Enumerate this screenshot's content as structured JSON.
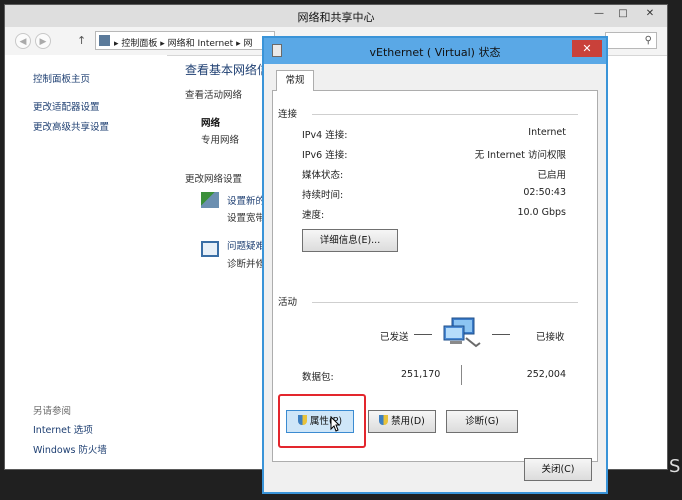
{
  "background_window": {
    "title": "网络和共享中心",
    "window_buttons": {
      "minimize": "—",
      "maximize": "□",
      "close": "✕"
    },
    "nav": {
      "back": "◀",
      "forward": "▶",
      "up": "↑",
      "breadcrumb": "▸ 控制面板 ▸ 网络和 Internet ▸ 网"
    },
    "left_pane": {
      "home_link": "控制面板主页",
      "adapter_link": "更改适配器设置",
      "advanced_link": "更改高级共享设置",
      "see_also": "另请参阅",
      "internet_options": "Internet 选项",
      "firewall": "Windows 防火墙"
    },
    "main": {
      "title": "查看基本网络信",
      "active_networks": "查看活动网络",
      "network_name": "网络",
      "network_type": "专用网络",
      "change_settings": "更改网络设置",
      "setup_link": "设置新的",
      "setup_desc": "设置宽带",
      "troubleshoot_link": "问题疑难",
      "troubleshoot_desc": "诊断并修"
    },
    "overflow_letter": "S"
  },
  "dialog": {
    "title": "vEthernet ( Virtual) 状态",
    "close_glyph": "✕",
    "tab_general": "常规",
    "connection": {
      "group_label": "连接",
      "rows": [
        {
          "label": "IPv4 连接:",
          "value": "Internet"
        },
        {
          "label": "IPv6 连接:",
          "value": "无 Internet 访问权限"
        },
        {
          "label": "媒体状态:",
          "value": "已启用"
        },
        {
          "label": "持续时间:",
          "value": "02:50:43"
        },
        {
          "label": "速度:",
          "value": "10.0 Gbps"
        }
      ],
      "details_button": "详细信息(E)..."
    },
    "activity": {
      "group_label": "活动",
      "sent_label": "已发送",
      "received_label": "已接收",
      "packets_label": "数据包:",
      "packets_sent": "251,170",
      "packets_received": "252,004"
    },
    "buttons": {
      "properties": "属性(P)",
      "disable": "禁用(D)",
      "diagnose": "诊断(G)",
      "close": "关闭(C)"
    }
  },
  "colors": {
    "accent": "#3a94d8",
    "highlight": "#e3262d",
    "link": "#1e3f72"
  }
}
